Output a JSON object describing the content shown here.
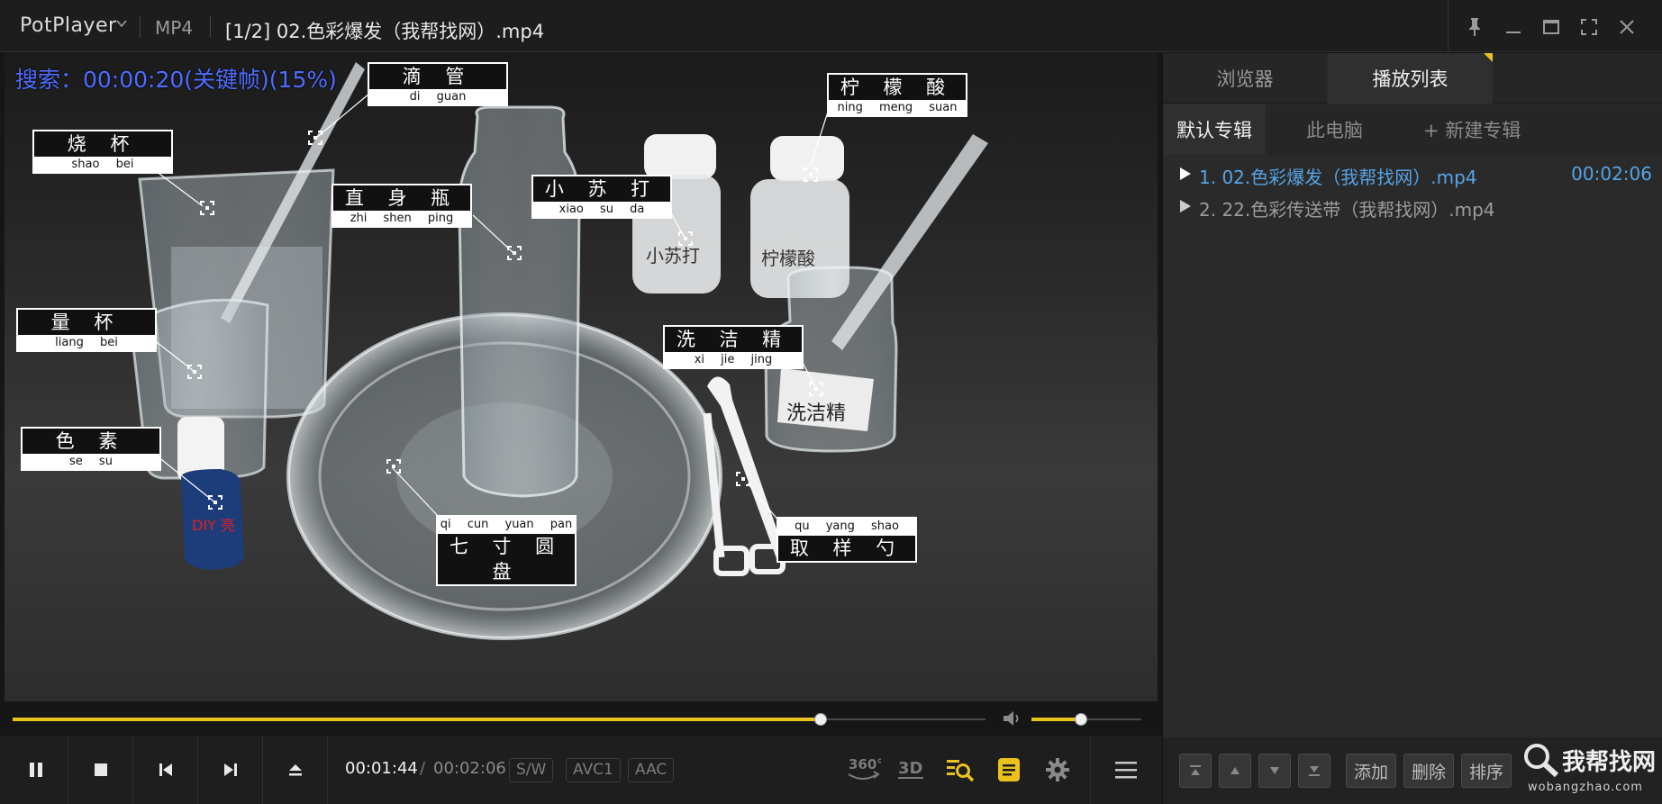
{
  "window": {
    "app_name": "PotPlayer",
    "format": "MP4",
    "title": "[1/2] 02.色彩爆发（我帮找网）.mp4"
  },
  "video": {
    "osd_text": "搜索：00:00:20(关键帧)(15%)",
    "labels": [
      {
        "cn": "滴 管",
        "pinyin": "di guan"
      },
      {
        "cn": "柠 檬 酸",
        "pinyin": "ning meng suan"
      },
      {
        "cn": "烧 杯",
        "pinyin": "shao bei"
      },
      {
        "cn": "直 身 瓶",
        "pinyin": "zhi shen ping"
      },
      {
        "cn": "小 苏 打",
        "pinyin": "xiao su da"
      },
      {
        "cn": "量 杯",
        "pinyin": "liang bei"
      },
      {
        "cn": "洗 洁 精",
        "pinyin": "xi jie jing"
      },
      {
        "cn": "色 素",
        "pinyin": "se su"
      },
      {
        "cn": "七 寸 圆 盘",
        "pinyin": "qi cun yuan pan"
      },
      {
        "cn": "取 样 勺",
        "pinyin": "qu yang shao"
      }
    ],
    "bottle_labels": {
      "soda": "小苏打",
      "citric": "柠檬酸",
      "detergent": "洗洁精",
      "dye": "DIY 亮"
    }
  },
  "playback": {
    "progress": 0.831,
    "volume": 0.45,
    "current_time": "00:01:44",
    "separator": "/",
    "total_time": "00:02:06",
    "tags": [
      "S/W",
      "AVC1",
      "AAC"
    ]
  },
  "panel": {
    "tabs": [
      "浏览器",
      "播放列表"
    ],
    "active_tab": "播放列表",
    "subtabs": [
      "默认专辑",
      "此电脑",
      "+ 新建专辑"
    ],
    "items": [
      {
        "name": "1. 02.色彩爆发（我帮找网）.mp4",
        "duration": "00:02:06",
        "active": true
      },
      {
        "name": "2. 22.色彩传送带（我帮找网）.mp4",
        "duration": "",
        "active": false
      }
    ],
    "buttons": [
      "添加",
      "删除",
      "排序"
    ]
  },
  "watermark": {
    "text": "我帮找网",
    "url": "wobangzhao.com"
  },
  "colors": {
    "accent": "#e9c21d",
    "active_item": "#56a4e6",
    "osd": "#4e6cff"
  }
}
